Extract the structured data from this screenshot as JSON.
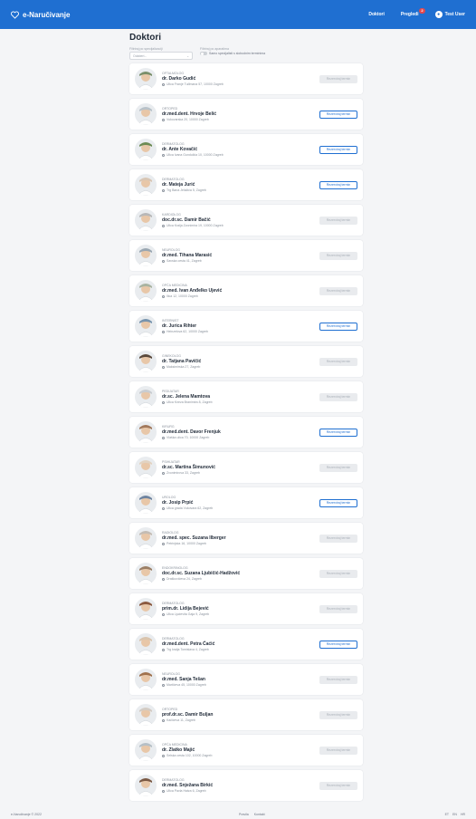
{
  "header": {
    "brand": "e-Naručivanje",
    "nav": {
      "doctors": "Doktori",
      "reviews": "Pregledi",
      "reviews_badge": "2",
      "user": "Test User"
    }
  },
  "page": {
    "title": "Doktori"
  },
  "filters": {
    "spec_label": "Filtriraj po specijalizaciji",
    "spec_placeholder": "Odaberi...",
    "toggle_title": "Filtriraj po aparatima",
    "toggle_text": "Samo specijalisti s slobodnim terminima"
  },
  "doctors": [
    {
      "spec": "OFTALMOLOG",
      "name": "dr. Darko Gudić",
      "addr": "Ulica Franje Tuđmana 57, 10000 Zagreb",
      "btn": "Rezerviraj termin",
      "active": false,
      "bg": "#7a8f6a"
    },
    {
      "spec": "ORTOPED",
      "name": "dr.med.dent. Hrvoje Belić",
      "addr": "Vukovarska 20, 10000 Zagreb",
      "btn": "Rezerviraj termin",
      "active": true,
      "bg": "#b9c2c9"
    },
    {
      "spec": "DERMATOLOG",
      "name": "dr. Ante Kovačić",
      "addr": "Ulica Ivana Gundulića 10, 10000 Zagreb",
      "btn": "Rezerviraj termin",
      "active": true,
      "bg": "#6d8b54"
    },
    {
      "spec": "DERMATOLOG",
      "name": "dr. Mateja Jurić",
      "addr": "Trg Bana Jelačića 5, Zagreb",
      "btn": "Rezerviraj termin",
      "active": true,
      "bg": "#d8c6b4"
    },
    {
      "spec": "KARDIOLOG",
      "name": "doc.dr.sc. Damir Bačić",
      "addr": "Ulica Kralja Zvonimira 19, 10000 Zagreb",
      "btn": "Rezerviraj termin",
      "active": false,
      "bg": "#b8b8b8"
    },
    {
      "spec": "NEUROLOG",
      "name": "dr.med. Tihana Marasić",
      "addr": "Savska cesta 41, Zagreb",
      "btn": "Rezerviraj termin",
      "active": false,
      "bg": "#9aa7b2"
    },
    {
      "spec": "OPĆA MEDICINA",
      "name": "dr.med. Ivan Anđelko Ujević",
      "addr": "Ilica 12, 10000 Zagreb",
      "btn": "Rezerviraj termin",
      "active": false,
      "bg": "#a9b3a1"
    },
    {
      "spec": "INTERNIST",
      "name": "dr. Jurica Rihter",
      "addr": "Heinzelova 62, 10000 Zagreb",
      "btn": "Rezerviraj termin",
      "active": true,
      "bg": "#7894ad"
    },
    {
      "spec": "GINEKOLOG",
      "name": "dr. Tatjana Pavičić",
      "addr": "Maksimirska 27, Zagreb",
      "btn": "Rezerviraj termin",
      "active": false,
      "bg": "#5b4a3c"
    },
    {
      "spec": "PEDIJATAR",
      "name": "dr.sc. Jelena Mamtova",
      "addr": "Ulica Kneza Branimira 8, Zagreb",
      "btn": "Rezerviraj termin",
      "active": false,
      "bg": "#c9cdd1"
    },
    {
      "spec": "KIRURG",
      "name": "dr.med.dent. Davor Frenjuk",
      "addr": "Vlaška ulica 70, 10000 Zagreb",
      "btn": "Rezerviraj termin",
      "active": true,
      "bg": "#a2795c"
    },
    {
      "spec": "PSIHIJATAR",
      "name": "dr.sc. Martina Šimunović",
      "addr": "Zvonimirova 33, Zagreb",
      "btn": "Rezerviraj termin",
      "active": false,
      "bg": "#e2d3c2"
    },
    {
      "spec": "UROLOG",
      "name": "dr. Josip Prpić",
      "addr": "Ulica grada Vukovara 62, Zagreb",
      "btn": "Rezerviraj termin",
      "active": true,
      "bg": "#6f84a0"
    },
    {
      "spec": "RADIOLOG",
      "name": "dr.med. spec. Suzana Ilberger",
      "addr": "Petrinjska 16, 10000 Zagreb",
      "btn": "Rezerviraj termin",
      "active": false,
      "bg": "#c4bcb4"
    },
    {
      "spec": "ENDOKRINOLOG",
      "name": "doc.dr.sc. Suzana Ljubičić-Hadžović",
      "addr": "Draškovićeva 24, Zagreb",
      "btn": "Rezerviraj termin",
      "active": false,
      "bg": "#9b7f66"
    },
    {
      "spec": "DERMATOLOG",
      "name": "prim.dr. Lidija Bejević",
      "addr": "Ulica Ljudevita Gaja 9, Zagreb",
      "btn": "Rezerviraj termin",
      "active": false,
      "bg": "#8c5a3f"
    },
    {
      "spec": "DERMATOLOG",
      "name": "dr.med.dent. Petra Ćaćić",
      "addr": "Trg kralja Tomislava 4, Zagreb",
      "btn": "Rezerviraj termin",
      "active": true,
      "bg": "#d9c4ad"
    },
    {
      "spec": "NEUROLOG",
      "name": "dr.med. Sanja Tešan",
      "addr": "Martićeva 45, 10000 Zagreb",
      "btn": "Rezerviraj termin",
      "active": false,
      "bg": "#a0724d"
    },
    {
      "spec": "ORTOPED",
      "name": "prof.dr.sc. Damir Buljan",
      "addr": "Kačićeva 11, Zagreb",
      "btn": "Rezerviraj termin",
      "active": false,
      "bg": "#d3cbc3"
    },
    {
      "spec": "OPĆA MEDICINA",
      "name": "dr. Zlatko Majić",
      "addr": "Selska cesta 102, 10000 Zagreb",
      "btn": "Rezerviraj termin",
      "active": false,
      "bg": "#b6bfc6"
    },
    {
      "spec": "DERMATOLOG",
      "name": "dr.med. Snježana Birkić",
      "addr": "Ulica Pavla Hatza 6, Zagreb",
      "btn": "Rezerviraj termin",
      "active": false,
      "bg": "#7b5a45"
    }
  ],
  "footer": {
    "copyright": "e-Naručivanje © 2022",
    "links": [
      "Pravila",
      "Kontakt"
    ],
    "right": [
      "ET",
      "EN",
      "HR"
    ]
  }
}
